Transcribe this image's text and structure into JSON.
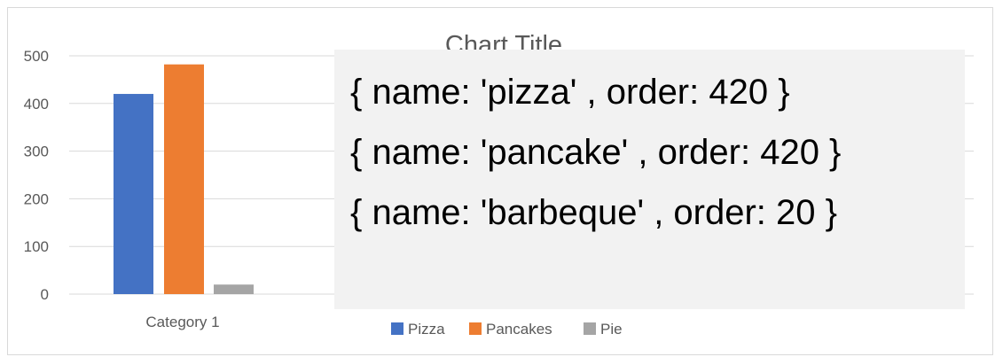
{
  "chart_data": {
    "type": "bar",
    "title": "Chart Title",
    "categories": [
      "Category 1"
    ],
    "series": [
      {
        "name": "Pizza",
        "values": [
          420
        ],
        "color": "#4472c4"
      },
      {
        "name": "Pancakes",
        "values": [
          482
        ],
        "color": "#ed7d31"
      },
      {
        "name": "Pie",
        "values": [
          20
        ],
        "color": "#a5a5a5"
      }
    ],
    "ylim": [
      0,
      500
    ],
    "yticks": [
      0,
      100,
      200,
      300,
      400,
      500
    ],
    "ytick_labels": [
      "0",
      "100",
      "200",
      "300",
      "400",
      "500"
    ],
    "grid": true,
    "legend_position": "bottom"
  },
  "overlay": {
    "lines": [
      "{ name: 'pizza' , order: 420 }",
      "{ name: 'pancake' , order: 420 }",
      "{ name: 'barbeque' , order: 20 }"
    ]
  }
}
